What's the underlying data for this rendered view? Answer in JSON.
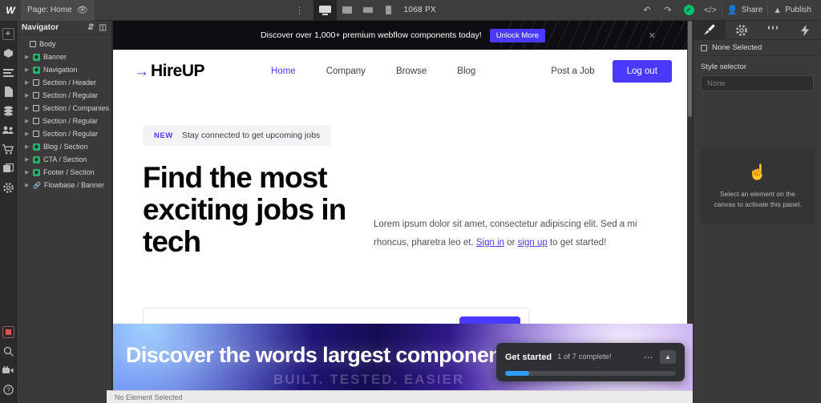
{
  "topbar": {
    "logo": "W",
    "page_label": "Page: Home",
    "eye_icon": "eye-icon",
    "kebab_icon": "more-options-icon",
    "breakpoints": [
      {
        "name": "desktop",
        "label": "Desktop",
        "active": true
      },
      {
        "name": "tablet",
        "label": "Tablet",
        "active": false
      },
      {
        "name": "mobile-landscape",
        "label": "Mobile landscape",
        "active": false
      },
      {
        "name": "mobile-portrait",
        "label": "Mobile portrait",
        "active": false
      }
    ],
    "canvas_width": "1068 PX",
    "undo_icon": "undo-icon",
    "redo_icon": "redo-icon",
    "save_status_icon": "checkmark-saved-icon",
    "code_icon": "code-brackets-icon",
    "share_label": "Share",
    "share_icon": "person-icon",
    "publish_label": "Publish",
    "publish_icon": "rocket-icon",
    "save_color": "#00c16e"
  },
  "rail": {
    "items": [
      {
        "name": "add-elements-icon",
        "glyph": "+"
      },
      {
        "name": "components-icon",
        "glyph": "⬡"
      },
      {
        "name": "navigator-icon",
        "glyph": "☰"
      },
      {
        "name": "pages-icon",
        "glyph": "✐"
      },
      {
        "name": "cms-icon",
        "glyph": "☲"
      },
      {
        "name": "users-icon",
        "glyph": "☰"
      },
      {
        "name": "ecommerce-icon",
        "glyph": "☰"
      },
      {
        "name": "assets-icon",
        "glyph": "☐"
      },
      {
        "name": "settings-icon",
        "glyph": "⚙"
      }
    ],
    "bottom_items": [
      {
        "name": "video-record-icon",
        "glyph": ""
      },
      {
        "name": "search-icon",
        "glyph": "⌕"
      },
      {
        "name": "video-tutorials-icon",
        "glyph": "▶"
      },
      {
        "name": "help-icon",
        "glyph": "?"
      }
    ]
  },
  "navigator": {
    "title": "Navigator",
    "sort_icon": "sort-updown-icon",
    "panel_icon": "panel-toggle-icon",
    "items": [
      {
        "label": "Body",
        "type": "square",
        "caret": false,
        "indent": 0
      },
      {
        "label": "Banner",
        "type": "component",
        "caret": true,
        "indent": 1
      },
      {
        "label": "Navigation",
        "type": "component",
        "caret": true,
        "indent": 1
      },
      {
        "label": "Section / Header",
        "type": "square",
        "caret": true,
        "indent": 1
      },
      {
        "label": "Section / Regular",
        "type": "square",
        "caret": true,
        "indent": 1
      },
      {
        "label": "Section / Companies",
        "type": "square",
        "caret": true,
        "indent": 1
      },
      {
        "label": "Section / Regular",
        "type": "square",
        "caret": true,
        "indent": 1
      },
      {
        "label": "Section / Regular",
        "type": "square",
        "caret": true,
        "indent": 1
      },
      {
        "label": "Blog / Section",
        "type": "component",
        "caret": true,
        "indent": 1
      },
      {
        "label": "CTA / Section",
        "type": "component",
        "caret": true,
        "indent": 1
      },
      {
        "label": "Footer / Section",
        "type": "component",
        "caret": true,
        "indent": 1
      },
      {
        "label": "Flowbase / Banner",
        "type": "link",
        "caret": true,
        "indent": 1
      }
    ]
  },
  "site": {
    "banner": {
      "text": "Discover over 1,000+ premium webflow components today!",
      "button_label": "Unlock More",
      "close_icon": "close-x-icon",
      "button_color": "#4a3aff"
    },
    "nav": {
      "logo_arrow": "→",
      "logo_text": "HireUP",
      "links": [
        {
          "label": "Home",
          "active": true
        },
        {
          "label": "Company",
          "active": false
        },
        {
          "label": "Browse",
          "active": false
        },
        {
          "label": "Blog",
          "active": false
        }
      ],
      "post_job_label": "Post a Job",
      "logout_label": "Log out",
      "accent_color": "#4a3aff"
    },
    "hero": {
      "badge_label": "NEW",
      "badge_text": "Stay connected to get upcoming jobs",
      "heading": "Find the most exciting jobs in tech",
      "paragraph_before": "Lorem ipsum dolor sit amet, consectetur adipiscing elit. Sed a mi rhoncus, pharetra leo et. ",
      "link_signin": "Sign in",
      "paragraph_mid": " or ",
      "link_signup": "sign up",
      "paragraph_after": " to get started!",
      "search_icon": "magnifier-icon",
      "search_placeholder": ""
    }
  },
  "promo": {
    "title": "Discover the words largest component",
    "subtitle": "BUILT. TESTED. EASIER"
  },
  "get_started": {
    "title": "Get started",
    "progress_text": "1 of 7 complete!",
    "menu_icon": "ellipsis-icon",
    "collapse_icon": "chevron-up-icon",
    "progress_percent": 14,
    "bar_color": "#2e9bff"
  },
  "statusbar": {
    "text": "No Element Selected"
  },
  "rightpanel": {
    "tabs": [
      {
        "name": "style-tab",
        "glyph": "✎",
        "active": true
      },
      {
        "name": "settings-tab",
        "glyph": "⚙",
        "active": false
      },
      {
        "name": "interactions-tab",
        "glyph": "⑆",
        "active": false
      },
      {
        "name": "effects-tab",
        "glyph": "⚡",
        "active": false
      }
    ],
    "selection_label": "None Selected",
    "style_selector_label": "Style selector",
    "style_selector_value": "None",
    "empty_icon": "click-hand-icon",
    "empty_text": "Select an element on the canvas to activate this panel."
  }
}
